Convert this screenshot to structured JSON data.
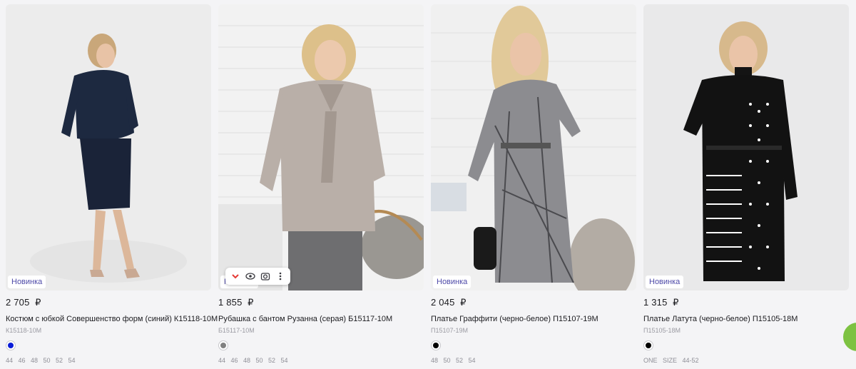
{
  "currency": "₽",
  "products": [
    {
      "price": "2 705",
      "title": "Костюм с юбкой Совершенство форм (синий) К15118-10М",
      "sku": "К15118-10М",
      "badge": "Новинка",
      "swatch": "#0a1cd8",
      "sizes": "44 46 48 50 52 54"
    },
    {
      "price": "1 855",
      "title": "Рубашка с бантом Рузанна (серая) Б15117-10М",
      "sku": "Б15117-10М",
      "badge": "Новинка",
      "swatch": "#808080",
      "sizes": "44 46 48 50 52 54"
    },
    {
      "price": "2 045",
      "title": "Платье Граффити (черно-белое) П15107-19М",
      "sku": "П15107-19М",
      "badge": "Новинка",
      "swatch": "#000000",
      "sizes": "48 50 52 54"
    },
    {
      "price": "1 315",
      "title": "Платье Латута (черно-белое) П15105-18М",
      "sku": "П15105-18М",
      "badge": "Новинка",
      "swatch": "#000000",
      "sizes": "ONE SIZE 44-52"
    }
  ],
  "image_toolbar": {
    "icons": [
      "chevron-down-icon",
      "eye-icon",
      "lens-icon",
      "more-vertical-icon"
    ]
  }
}
